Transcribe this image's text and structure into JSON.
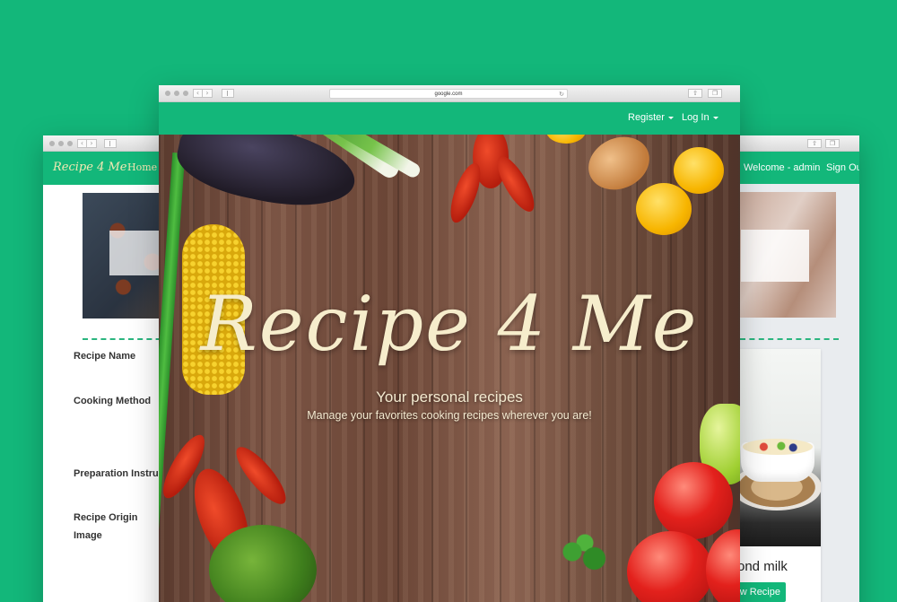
{
  "left_window": {
    "brand": "Recipe 4 Me",
    "nav_home": "Home",
    "form_labels": [
      "Recipe Name",
      "Cooking Method",
      "Preparation Instruc",
      "Recipe Origin",
      "Image"
    ]
  },
  "right_window": {
    "welcome": "Welcome - admin",
    "sign_out": "Sign Ou",
    "card": {
      "title": "ond milk",
      "button": "w Recipe"
    }
  },
  "center_window": {
    "url": "google.com",
    "nav": {
      "register": "Register",
      "login": "Log In"
    },
    "hero": {
      "title": "Recipe 4 Me",
      "subtitle": "Your personal recipes",
      "tagline": "Manage your favorites cooking recipes wherever you are!"
    }
  },
  "icons": [
    "chevron-left-icon",
    "chevron-right-icon",
    "sidebar-icon",
    "share-icon",
    "tabs-icon",
    "reload-icon",
    "caret-down-icon"
  ],
  "colors": {
    "brand_green": "#13b77a",
    "hero_text": "#f6edcc",
    "brand_text": "#f3e8b3"
  }
}
